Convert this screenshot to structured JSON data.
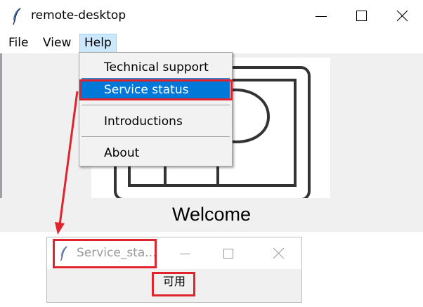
{
  "main_window": {
    "title": "remote-desktop",
    "icon": "feather-icon",
    "controls": [
      "minimize-icon",
      "maximize-icon",
      "close-icon"
    ]
  },
  "menubar": {
    "items": [
      {
        "label": "File"
      },
      {
        "label": "View"
      },
      {
        "label": "Help",
        "active": true
      }
    ]
  },
  "help_menu": {
    "items": [
      {
        "label": "Technical support"
      },
      {
        "label": "Service status",
        "selected": true
      },
      {
        "label": "Introductions"
      },
      {
        "label": "About"
      }
    ]
  },
  "welcome": {
    "text": "Welcome"
  },
  "popup": {
    "title": "Service_sta...",
    "icon": "feather-icon",
    "controls": [
      "minimize-icon",
      "maximize-icon",
      "close-icon"
    ],
    "value": "可用"
  },
  "colors": {
    "annotation": "#e0242e",
    "menu_selection": "#0078d7",
    "menu_active": "#cce8ff",
    "window_bg": "#f0f0f0"
  }
}
